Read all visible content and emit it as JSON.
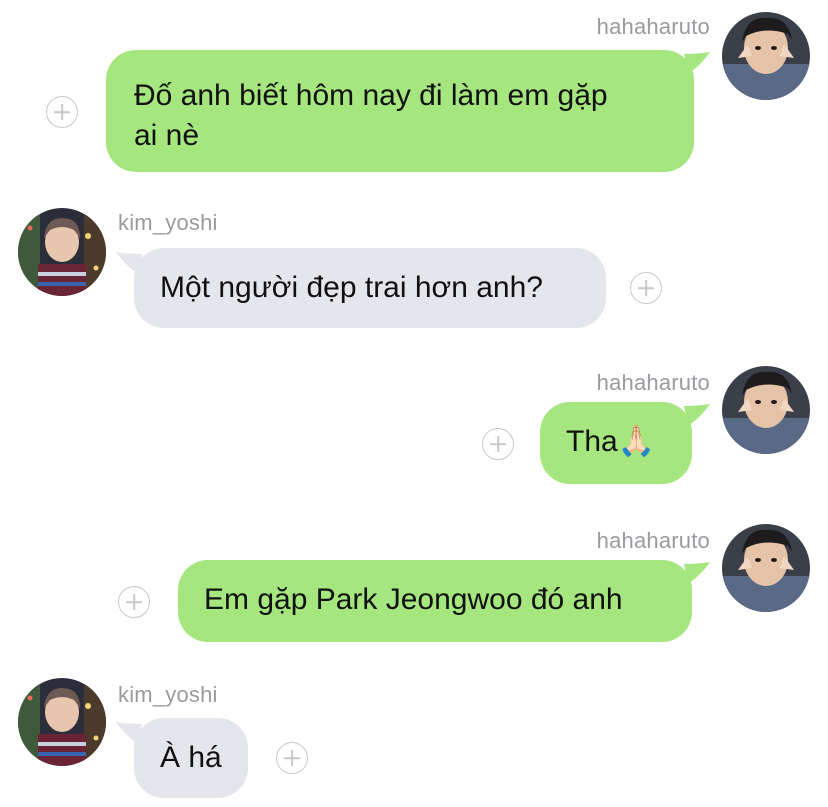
{
  "messages": [
    {
      "username": "hahaharuto",
      "text": "Đố anh biết hôm nay đi làm em gặp\nai nè"
    },
    {
      "username": "kim_yoshi",
      "text": "Một người đẹp trai hơn anh?"
    },
    {
      "username": "hahaharuto",
      "text": "Tha",
      "emoji": "🙏🏻"
    },
    {
      "username": "hahaharuto",
      "text": "Em gặp Park Jeongwoo đó anh"
    },
    {
      "username": "kim_yoshi",
      "text": "À há"
    }
  ],
  "colors": {
    "outgoing_bubble": "#a6e67e",
    "incoming_bubble": "#e4e6eb",
    "username": "#9a9a9f",
    "add_reaction_icon": "#c8c8cc"
  },
  "icons": {
    "add_reaction": "plus-circle-icon"
  }
}
